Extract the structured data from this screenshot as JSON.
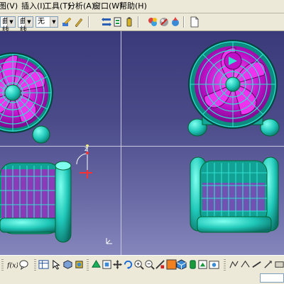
{
  "menubar": {
    "items": [
      {
        "label": "图(V)"
      },
      {
        "label": "插入(I)"
      },
      {
        "label": "工具(T)"
      },
      {
        "label": "分析(A)"
      },
      {
        "label": "窗口(W)"
      },
      {
        "label": "帮助(H)"
      }
    ]
  },
  "toolbar1": {
    "combo1_value": "曲线",
    "combo2_value": "曲线",
    "combo3_value": "无"
  },
  "viewport": {
    "views": [
      "front-view",
      "isometric-view",
      "side-view",
      "rear-side-view"
    ],
    "model_colors": {
      "body": "#1fc7b8",
      "blades": "#c010c8",
      "background": "#4b4b8a"
    },
    "compass_label": "z"
  },
  "colors": {
    "chrome": "#ece9d8",
    "accent": "#7f9db9"
  }
}
